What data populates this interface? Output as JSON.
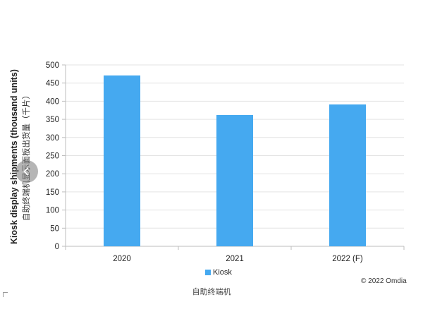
{
  "toolbar": {
    "icons": [
      "back-arrow-icon",
      "forward-arrow-icon",
      "grid-icon",
      "zoom-in-icon",
      "zoom-out-icon",
      "fit-page-icon",
      "rotate-icon",
      "edit-icon",
      "copy-image-icon",
      "scan-icon",
      "download-icon",
      "more-icon",
      "minimize-icon",
      "maximize-icon",
      "close-icon"
    ],
    "more_glyph": "•••"
  },
  "colors": {
    "bar": "#45a9f0",
    "grid": "#e3e3e3",
    "axis": "#bdbdbd"
  },
  "chart_data": {
    "type": "bar",
    "categories": [
      "2020",
      "2021",
      "2022 (F)"
    ],
    "series": [
      {
        "name": "Kiosk",
        "values": [
          471,
          362,
          391
        ]
      }
    ],
    "ylim": [
      0,
      500
    ],
    "yticks": [
      "0",
      "50",
      "100",
      "150",
      "200",
      "250",
      "300",
      "350",
      "400",
      "450",
      "500"
    ],
    "ylabel": "Kiosk display shipments (thousand units)",
    "ylabel_zh": "自助终端机显示面板出货量（千片）",
    "xlabel_zh": "自助终端机",
    "legend_position": "bottom",
    "credit": "© 2022 Omdia",
    "grid": true
  }
}
